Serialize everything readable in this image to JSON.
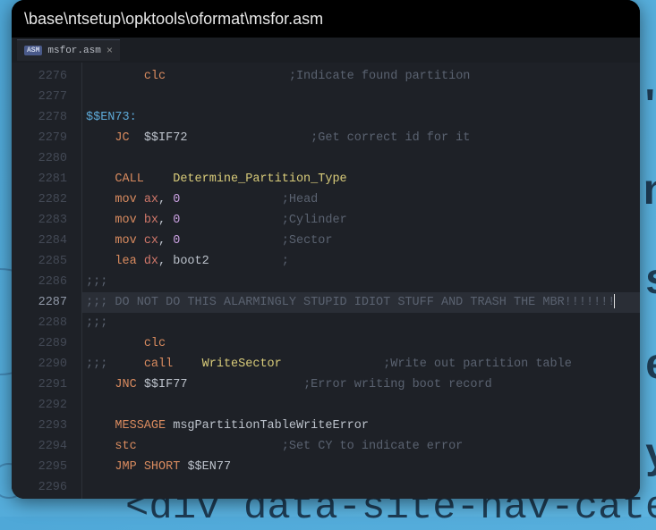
{
  "window": {
    "title": "\\base\\ntsetup\\opktools\\oformat\\msfor.asm"
  },
  "tab": {
    "badge": "ASM",
    "filename": "msfor.asm",
    "close": "×"
  },
  "gutter": {
    "start": 2276,
    "current": 2287,
    "count": 21
  },
  "code": {
    "lines": [
      {
        "segs": [
          {
            "t": "        "
          },
          {
            "t": "clc",
            "c": "kw"
          },
          {
            "t": "                 "
          },
          {
            "t": ";Indicate found partition",
            "c": "cmt"
          }
        ]
      },
      {
        "segs": []
      },
      {
        "segs": [
          {
            "t": "$$EN73:",
            "c": "label"
          }
        ]
      },
      {
        "segs": [
          {
            "t": "    "
          },
          {
            "t": "JC",
            "c": "kw"
          },
          {
            "t": "  "
          },
          {
            "t": "$$IF72",
            "c": "id"
          },
          {
            "t": "                 "
          },
          {
            "t": ";Get correct id for it",
            "c": "cmt"
          }
        ]
      },
      {
        "segs": []
      },
      {
        "segs": [
          {
            "t": "    "
          },
          {
            "t": "CALL",
            "c": "kw"
          },
          {
            "t": "    "
          },
          {
            "t": "Determine_Partition_Type",
            "c": "fn"
          }
        ]
      },
      {
        "segs": [
          {
            "t": "    "
          },
          {
            "t": "mov",
            "c": "kw"
          },
          {
            "t": " "
          },
          {
            "t": "ax",
            "c": "reg"
          },
          {
            "t": ", "
          },
          {
            "t": "0",
            "c": "num"
          },
          {
            "t": "              "
          },
          {
            "t": ";Head",
            "c": "cmt"
          }
        ]
      },
      {
        "segs": [
          {
            "t": "    "
          },
          {
            "t": "mov",
            "c": "kw"
          },
          {
            "t": " "
          },
          {
            "t": "bx",
            "c": "reg"
          },
          {
            "t": ", "
          },
          {
            "t": "0",
            "c": "num"
          },
          {
            "t": "              "
          },
          {
            "t": ";Cylinder",
            "c": "cmt"
          }
        ]
      },
      {
        "segs": [
          {
            "t": "    "
          },
          {
            "t": "mov",
            "c": "kw"
          },
          {
            "t": " "
          },
          {
            "t": "cx",
            "c": "reg"
          },
          {
            "t": ", "
          },
          {
            "t": "0",
            "c": "num"
          },
          {
            "t": "              "
          },
          {
            "t": ";Sector",
            "c": "cmt"
          }
        ]
      },
      {
        "segs": [
          {
            "t": "    "
          },
          {
            "t": "lea",
            "c": "kw"
          },
          {
            "t": " "
          },
          {
            "t": "dx",
            "c": "reg"
          },
          {
            "t": ", "
          },
          {
            "t": "boot2",
            "c": "id"
          },
          {
            "t": "          "
          },
          {
            "t": ";",
            "c": "cmt"
          }
        ]
      },
      {
        "segs": [
          {
            "t": ";;;",
            "c": "cmt"
          }
        ]
      },
      {
        "hl": true,
        "segs": [
          {
            "t": ";;; DO NOT DO THIS ALARMINGLY STUPID IDIOT STUFF AND TRASH THE MBR!!!!!!!",
            "c": "cmt"
          }
        ],
        "cursor": true
      },
      {
        "segs": [
          {
            "t": ";;;",
            "c": "cmt"
          }
        ]
      },
      {
        "segs": [
          {
            "t": "        "
          },
          {
            "t": "clc",
            "c": "kw"
          }
        ]
      },
      {
        "segs": [
          {
            "t": ";;;",
            "c": "cmt"
          },
          {
            "t": "     "
          },
          {
            "t": "call",
            "c": "kw"
          },
          {
            "t": "    "
          },
          {
            "t": "WriteSector",
            "c": "fn"
          },
          {
            "t": "              "
          },
          {
            "t": ";Write out partition table",
            "c": "cmt"
          }
        ]
      },
      {
        "segs": [
          {
            "t": "    "
          },
          {
            "t": "JNC",
            "c": "kw"
          },
          {
            "t": " "
          },
          {
            "t": "$$IF77",
            "c": "id"
          },
          {
            "t": "                "
          },
          {
            "t": ";Error writing boot record",
            "c": "cmt"
          }
        ]
      },
      {
        "segs": []
      },
      {
        "segs": [
          {
            "t": "    "
          },
          {
            "t": "MESSAGE",
            "c": "kw"
          },
          {
            "t": " "
          },
          {
            "t": "msgPartitionTableWriteError",
            "c": "id"
          }
        ]
      },
      {
        "segs": [
          {
            "t": "    "
          },
          {
            "t": "stc",
            "c": "kw"
          },
          {
            "t": "                    "
          },
          {
            "t": ";Set CY to indicate error",
            "c": "cmt"
          }
        ]
      },
      {
        "segs": [
          {
            "t": "    "
          },
          {
            "t": "JMP",
            "c": "kw"
          },
          {
            "t": " "
          },
          {
            "t": "SHORT",
            "c": "kw"
          },
          {
            "t": " "
          },
          {
            "t": "$$EN77",
            "c": "id"
          }
        ]
      },
      {
        "segs": []
      }
    ]
  },
  "bgtext": {
    "frag6": "<div data-site-nav-category"
  }
}
